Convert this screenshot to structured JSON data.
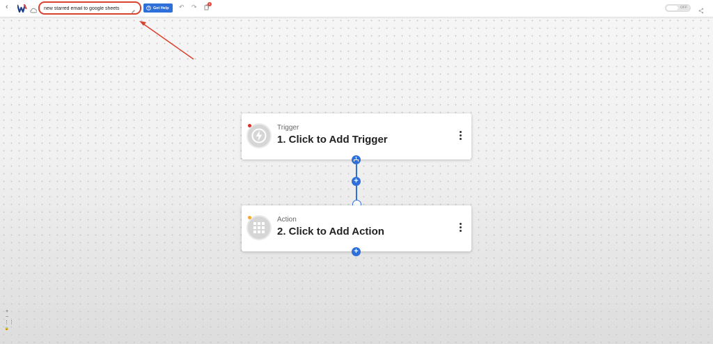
{
  "toolbar": {
    "back_glyph": "‹",
    "scenario_name": "new starred email to google sheets",
    "help_label": "Get Help",
    "undo_glyph": "↶",
    "redo_glyph": "↷",
    "notification_count": "0",
    "toggle_label": "OFF"
  },
  "trigger": {
    "type_label": "Trigger",
    "title": "1. Click to Add Trigger"
  },
  "action": {
    "type_label": "Action",
    "title": "2. Click to Add Action"
  },
  "canvas": {
    "plus_glyph": "+"
  },
  "zoom": {
    "zoom_in": "+",
    "zoom_out": "−",
    "fit": "⋮⋮",
    "lock": "🔒"
  },
  "colors": {
    "accent": "#2e6fd9",
    "highlight": "#d9412f",
    "trigger_status": "#d93025",
    "action_status": "#f2a92b"
  }
}
